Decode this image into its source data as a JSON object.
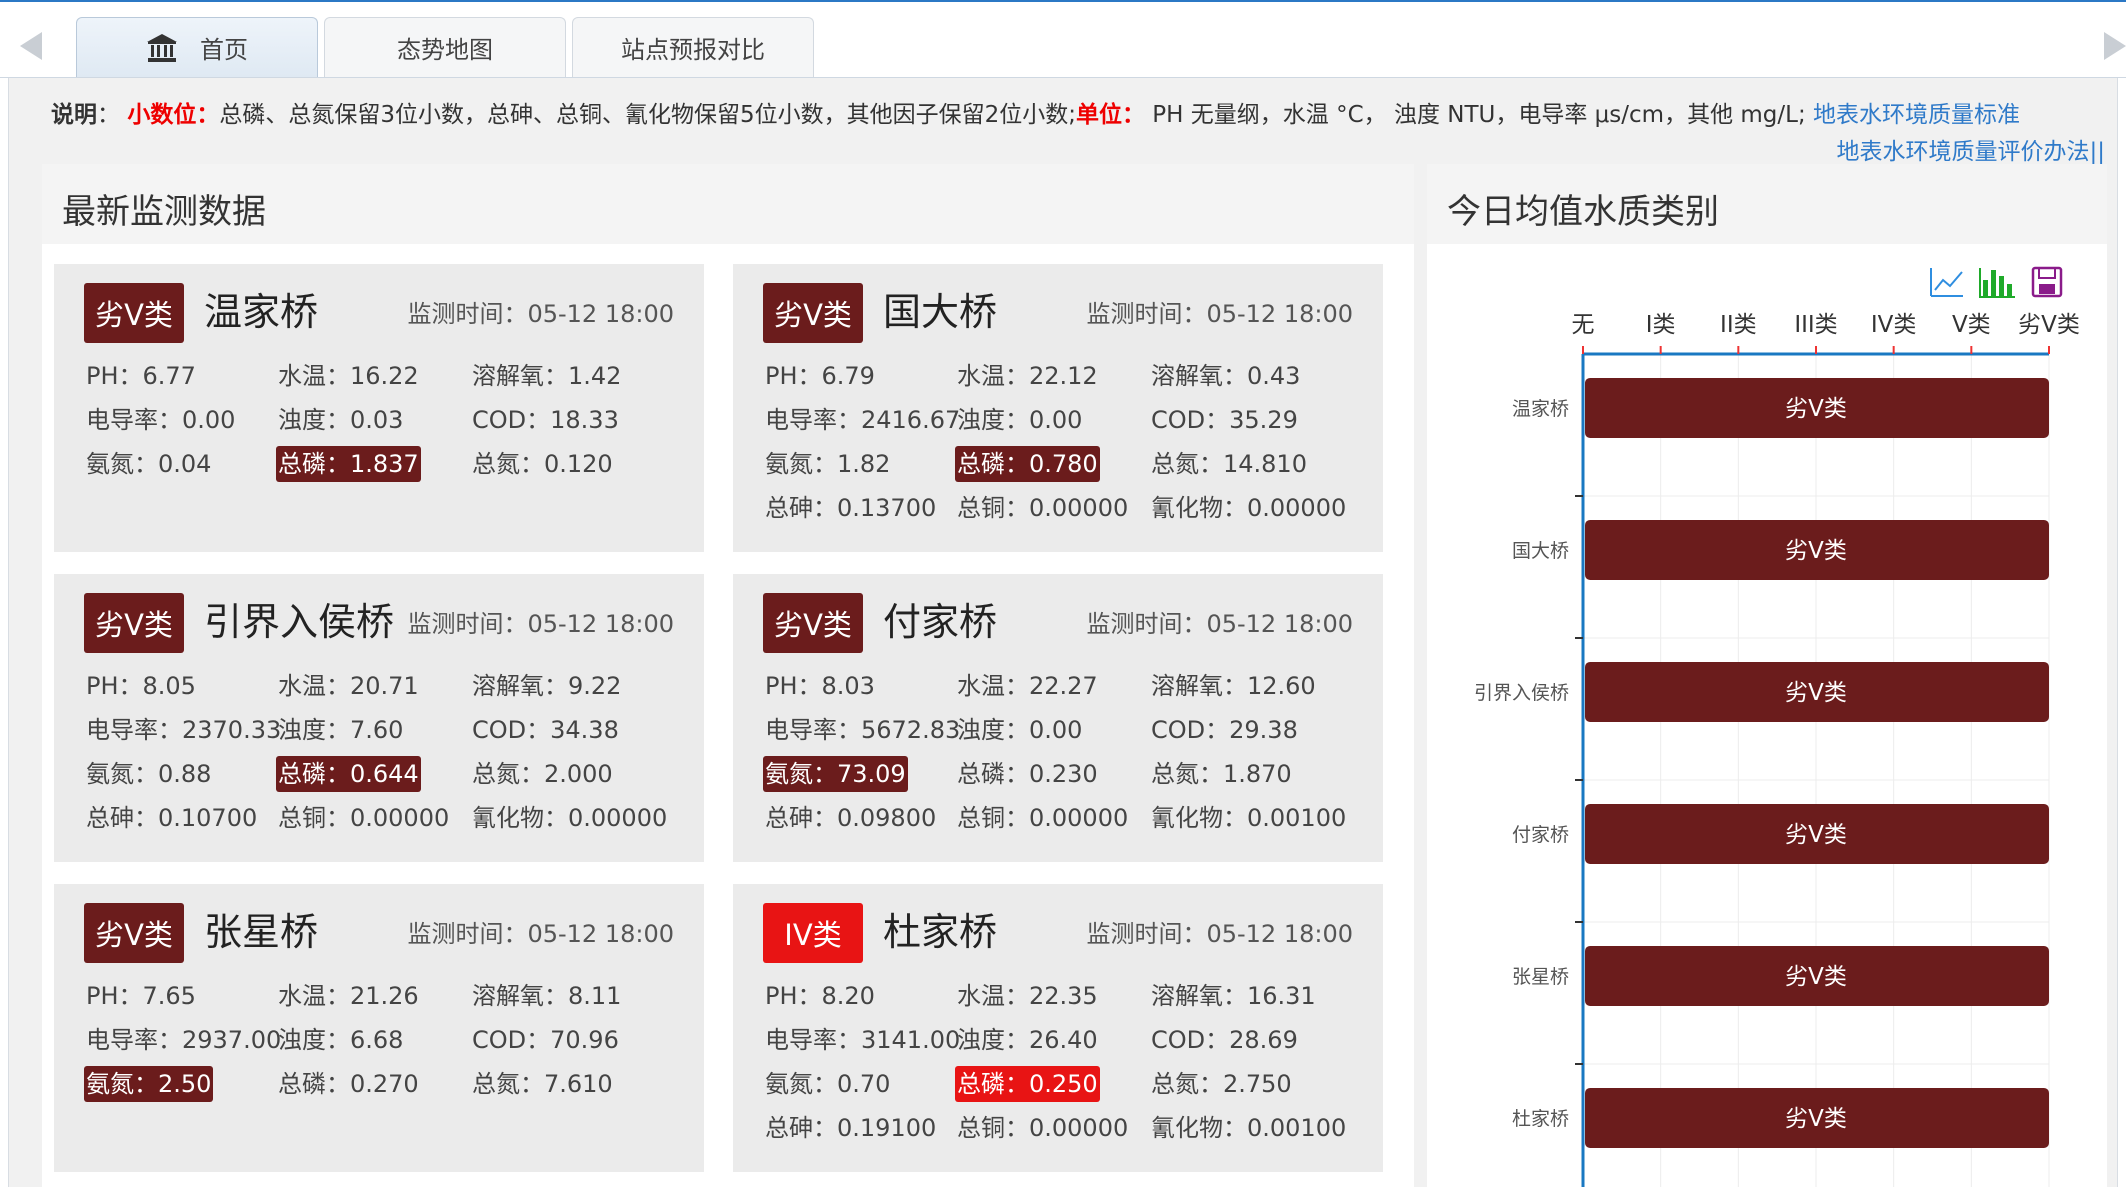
{
  "tabs": [
    {
      "label": "首页",
      "active": true
    },
    {
      "label": "态势地图",
      "active": false
    },
    {
      "label": "站点预报对比",
      "active": false
    }
  ],
  "notice": {
    "label": "说明",
    "decimals_label": "小数位",
    "decimals_text": "总磷、总氮保留3位小数，总砷、总铜、氰化物保留5位小数，其他因子保留2位小数;",
    "unit_label": "单位",
    "unit_text": "PH 无量纲，水温 °C， 浊度 NTU，电导率 μs/cm，其他 mg/L;",
    "link1": "地表水环境质量标准",
    "link2": "地表水环境质量评价办法||"
  },
  "left_panel": {
    "title": "最新监测数据"
  },
  "right_panel": {
    "title": "今日均值水质类别"
  },
  "colors": {
    "grade_inferior5": "#6b1c1c",
    "grade_4": "#e81414",
    "axis_blue": "#1a78c2",
    "tick_red": "#e33"
  },
  "stations": [
    {
      "name": "温家桥",
      "grade": "劣V类",
      "grade_color": "#6b1c1c",
      "time": "监测时间：05-12 18:00",
      "params": [
        {
          "text": "PH：6.77"
        },
        {
          "text": "水温：16.22"
        },
        {
          "text": "溶解氧：1.42"
        },
        {
          "text": "电导率：0.00"
        },
        {
          "text": "浊度：0.03"
        },
        {
          "text": "COD：18.33"
        },
        {
          "text": "氨氮：0.04"
        },
        {
          "text": "总磷：1.837",
          "hl": "#6b1c1c"
        },
        {
          "text": "总氮：0.120"
        }
      ]
    },
    {
      "name": "国大桥",
      "grade": "劣V类",
      "grade_color": "#6b1c1c",
      "time": "监测时间：05-12 18:00",
      "params": [
        {
          "text": "PH：6.79"
        },
        {
          "text": "水温：22.12"
        },
        {
          "text": "溶解氧：0.43"
        },
        {
          "text": "电导率：2416.67"
        },
        {
          "text": "浊度：0.00"
        },
        {
          "text": "COD：35.29"
        },
        {
          "text": "氨氮：1.82"
        },
        {
          "text": "总磷：0.780",
          "hl": "#6b1c1c"
        },
        {
          "text": "总氮：14.810"
        },
        {
          "text": "总砷：0.13700"
        },
        {
          "text": "总铜：0.00000"
        },
        {
          "text": "氰化物：0.00000"
        }
      ]
    },
    {
      "name": "引界入侯桥",
      "grade": "劣V类",
      "grade_color": "#6b1c1c",
      "time": "监测时间：05-12 18:00",
      "params": [
        {
          "text": "PH：8.05"
        },
        {
          "text": "水温：20.71"
        },
        {
          "text": "溶解氧：9.22"
        },
        {
          "text": "电导率：2370.33"
        },
        {
          "text": "浊度：7.60"
        },
        {
          "text": "COD：34.38"
        },
        {
          "text": "氨氮：0.88"
        },
        {
          "text": "总磷：0.644",
          "hl": "#6b1c1c"
        },
        {
          "text": "总氮：2.000"
        },
        {
          "text": "总砷：0.10700"
        },
        {
          "text": "总铜：0.00000"
        },
        {
          "text": "氰化物：0.00000"
        }
      ]
    },
    {
      "name": "付家桥",
      "grade": "劣V类",
      "grade_color": "#6b1c1c",
      "time": "监测时间：05-12 18:00",
      "params": [
        {
          "text": "PH：8.03"
        },
        {
          "text": "水温：22.27"
        },
        {
          "text": "溶解氧：12.60"
        },
        {
          "text": "电导率：5672.83"
        },
        {
          "text": "浊度：0.00"
        },
        {
          "text": "COD：29.38"
        },
        {
          "text": "氨氮：73.09",
          "hl": "#6b1c1c"
        },
        {
          "text": "总磷：0.230"
        },
        {
          "text": "总氮：1.870"
        },
        {
          "text": "总砷：0.09800"
        },
        {
          "text": "总铜：0.00000"
        },
        {
          "text": "氰化物：0.00100"
        }
      ]
    },
    {
      "name": "张星桥",
      "grade": "劣V类",
      "grade_color": "#6b1c1c",
      "time": "监测时间：05-12 18:00",
      "params": [
        {
          "text": "PH：7.65"
        },
        {
          "text": "水温：21.26"
        },
        {
          "text": "溶解氧：8.11"
        },
        {
          "text": "电导率：2937.00"
        },
        {
          "text": "浊度：6.68"
        },
        {
          "text": "COD：70.96"
        },
        {
          "text": "氨氮：2.50",
          "hl": "#6b1c1c"
        },
        {
          "text": "总磷：0.270"
        },
        {
          "text": "总氮：7.610"
        }
      ]
    },
    {
      "name": "杜家桥",
      "grade": "IV类",
      "grade_color": "#e81414",
      "time": "监测时间：05-12 18:00",
      "params": [
        {
          "text": "PH：8.20"
        },
        {
          "text": "水温：22.35"
        },
        {
          "text": "溶解氧：16.31"
        },
        {
          "text": "电导率：3141.00"
        },
        {
          "text": "浊度：26.40"
        },
        {
          "text": "COD：28.69"
        },
        {
          "text": "氨氮：0.70"
        },
        {
          "text": "总磷：0.250",
          "hl": "#e81414"
        },
        {
          "text": "总氮：2.750"
        },
        {
          "text": "总砷：0.19100"
        },
        {
          "text": "总铜：0.00000"
        },
        {
          "text": "氰化物：0.00100"
        }
      ]
    }
  ],
  "chart_data": {
    "type": "bar",
    "orientation": "horizontal",
    "x_categories": [
      "无",
      "I类",
      "II类",
      "III类",
      "IV类",
      "V类",
      "劣V类"
    ],
    "categories": [
      "温家桥",
      "国大桥",
      "引界入侯桥",
      "付家桥",
      "张星桥",
      "杜家桥"
    ],
    "values": [
      "劣V类",
      "劣V类",
      "劣V类",
      "劣V类",
      "劣V类",
      "劣V类"
    ],
    "value_index": [
      6,
      6,
      6,
      6,
      6,
      6
    ],
    "bar_color": "#6b1c1c",
    "grid": true,
    "toolbox": [
      "line-chart-icon",
      "bar-chart-icon",
      "save-icon"
    ]
  }
}
